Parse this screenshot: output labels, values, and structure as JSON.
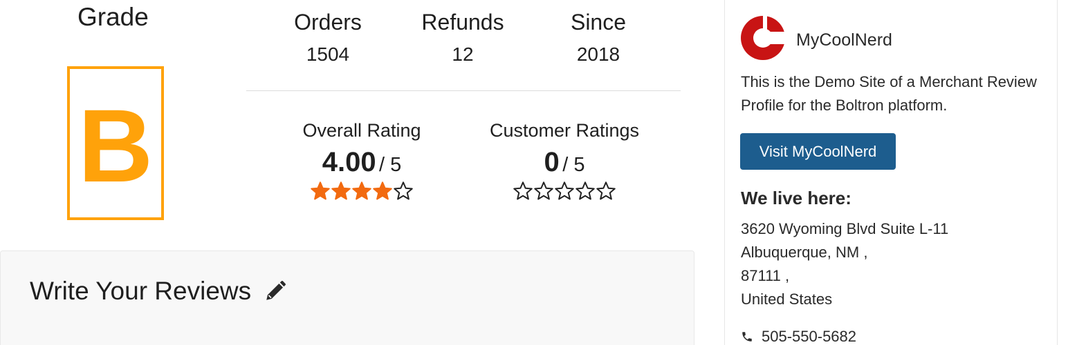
{
  "grade": {
    "title": "Grade",
    "letter": "B",
    "color": "#ffa20a"
  },
  "stats": [
    {
      "label": "Orders",
      "value": "1504"
    },
    {
      "label": "Refunds",
      "value": "12"
    },
    {
      "label": "Since",
      "value": "2018"
    }
  ],
  "ratings": {
    "overall": {
      "label": "Overall Rating",
      "score": "4.00",
      "denominator": "/ 5",
      "stars_filled": 4,
      "stars_total": 5
    },
    "customer": {
      "label": "Customer Ratings",
      "score": "0",
      "denominator": "/ 5",
      "stars_filled": 0,
      "stars_total": 5
    },
    "star_color": "#f26a10"
  },
  "review": {
    "title": "Write Your Reviews",
    "icon": "pencil-icon"
  },
  "merchant": {
    "name": "MyCoolNerd",
    "logo_color": "#c81414",
    "description": "This is the Demo Site of a Merchant Review Profile for the Boltron platform.",
    "visit_label": "Visit MyCoolNerd",
    "button_color": "#1d5d8e",
    "location_title": "We live here:",
    "address": {
      "line1": "3620 Wyoming Blvd Suite L-11",
      "line2": "Albuquerque, NM ,",
      "line3": "87111 ,",
      "line4": "United States"
    },
    "phone": "505-550-5682",
    "phone_icon": "phone-icon"
  }
}
